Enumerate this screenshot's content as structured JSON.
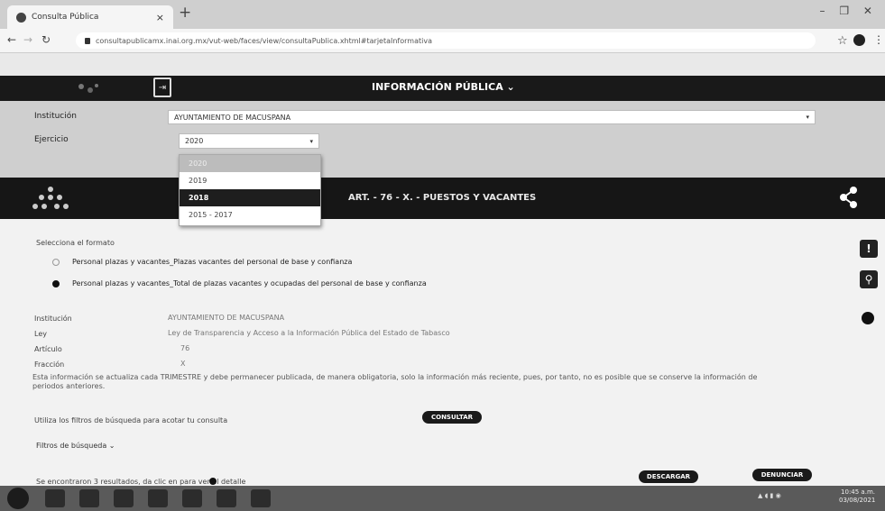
{
  "browser": {
    "tab_title": "Consulta Pública",
    "tab_close": "×",
    "new_tab": "+",
    "url": "consultapublicamx.inai.org.mx/vut-web/faces/view/consultaPublica.xhtml#tarjetaInformativa",
    "window_controls": "– ❐ ✕"
  },
  "header": {
    "title": "INFORMACIÓN PÚBLICA ⌄"
  },
  "filters": {
    "institucion_label": "Institución",
    "institucion_value": "AYUNTAMIENTO DE MACUSPANA",
    "ejercicio_label": "Ejercicio",
    "ejercicio_value": "2020",
    "ejercicio_options": [
      "2020",
      "2019",
      "2018",
      "2015 - 2017"
    ],
    "highlighted_option": "2020",
    "selected_option": "2018"
  },
  "article": {
    "title": "ART. - 76 - X. - PUESTOS Y VACANTES"
  },
  "main": {
    "format_prompt": "Selecciona el formato",
    "format_options": [
      "Personal plazas y vacantes_Plazas vacantes del personal de base y confianza",
      "Personal plazas y vacantes_Total de plazas vacantes y ocupadas del personal de base y confianza"
    ],
    "selected_format_index": 1,
    "details": [
      {
        "label": "Institución",
        "value": "AYUNTAMIENTO DE MACUSPANA"
      },
      {
        "label": "Ley",
        "value": "Ley de Transparencia y Acceso a la Información Pública del Estado de Tabasco"
      },
      {
        "label": "Artículo",
        "value": "76"
      },
      {
        "label": "Fracción",
        "value": "X"
      }
    ],
    "description": "Esta información se actualiza cada TRIMESTRE y debe permanecer publicada, de manera obligatoria, solo la información más reciente, pues, por tanto, no es posible que se conserve la información de periodos anteriores.",
    "filter_hint": "Utiliza los filtros de búsqueda para acotar tu consulta",
    "consult_button": "CONSULTAR",
    "search_filters": "Filtros de búsqueda ⌄",
    "results_text": "Se encontraron 3 resultados, da clic en   para ver el detalle",
    "download_button": "DESCARGAR",
    "report_button": "DENUNCIAR"
  },
  "taskbar": {
    "clock_time": "10:45 a.m.",
    "clock_date": "03/08/2021"
  }
}
